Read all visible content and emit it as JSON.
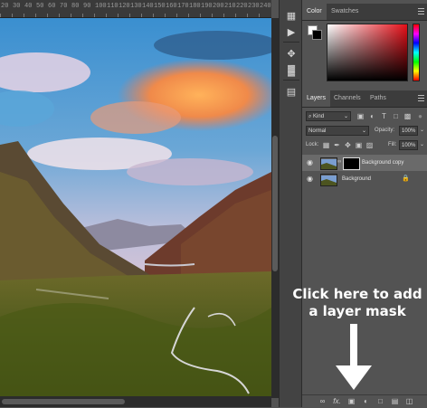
{
  "ruler": {
    "ticks": [
      "20",
      "30",
      "40",
      "50",
      "60",
      "70",
      "80",
      "90",
      "100",
      "110",
      "120",
      "130",
      "140",
      "150",
      "160",
      "170",
      "180",
      "190",
      "200",
      "210",
      "220",
      "230",
      "240"
    ]
  },
  "panels": {
    "color": {
      "tabs": [
        "Color",
        "Swatches"
      ],
      "active": 0
    },
    "layers": {
      "tabs": [
        "Layers",
        "Channels",
        "Paths"
      ],
      "active": 0,
      "filter_kind": "Kind",
      "blend_mode": "Normal",
      "opacity_label": "Opacity:",
      "opacity_value": "100%",
      "lock_label": "Lock:",
      "fill_label": "Fill:",
      "fill_value": "100%",
      "items": [
        {
          "name": "Background copy",
          "selected": true,
          "has_mask": true
        },
        {
          "name": "Background",
          "selected": false,
          "locked": true
        }
      ]
    },
    "bottom_icons": [
      "link-icon",
      "fx-icon",
      "add-mask-icon",
      "adjustment-icon",
      "folder-icon",
      "new-layer-icon",
      "trash-icon"
    ],
    "bottom_fx_label": "fx."
  },
  "callout": {
    "line1": "Click here to add",
    "line2": "a layer mask"
  },
  "colors": {
    "accent_arrow": "#ffffff",
    "panel_bg": "#535353",
    "selected_layer": "#6a6a6a"
  }
}
